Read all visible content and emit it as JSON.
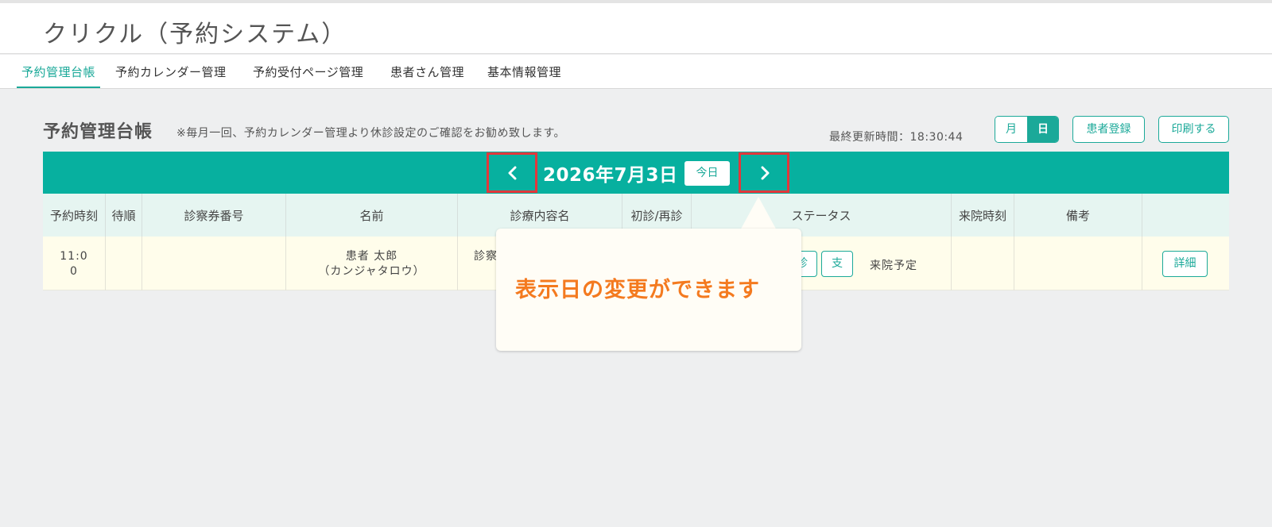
{
  "app": {
    "title": "クリクル（予約システム）"
  },
  "nav": {
    "tabs": [
      {
        "label": "予約管理台帳",
        "active": true
      },
      {
        "label": "予約カレンダー管理",
        "active": false
      },
      {
        "label": "予約受付ページ管理",
        "active": false
      },
      {
        "label": "患者さん管理",
        "active": false
      },
      {
        "label": "基本情報管理",
        "active": false
      }
    ]
  },
  "page": {
    "title": "予約管理台帳",
    "note": "※毎月一回、予約カレンダー管理より休診設定のご確認をお勧め致します。",
    "last_updated": "最終更新時間：18:30:44"
  },
  "view_toggle": {
    "month": "月",
    "day": "日",
    "selected": "日"
  },
  "actions": {
    "register_patient": "患者登録",
    "print": "印刷する"
  },
  "datebar": {
    "date": "2026年7月3日",
    "today": "今日"
  },
  "table": {
    "headers": [
      "予約時刻",
      "待順",
      "診察券番号",
      "名前",
      "診療内容名",
      "初診/再診",
      "ステータス",
      "来院時刻",
      "備考",
      ""
    ],
    "rows": [
      {
        "time_line1": "11:0",
        "time_line2": "0",
        "order": "",
        "card_no": "",
        "name": "患者 太郎",
        "kana": "（カンジャタロウ）",
        "course": "診察",
        "status_btn1": "診",
        "status_btn2": "支",
        "status": "来院予定",
        "arrival": "",
        "memo": "",
        "detail": "詳細"
      }
    ]
  },
  "callout": {
    "text": "表示日の変更ができます"
  },
  "colors": {
    "accent": "#1ba999",
    "bar": "#07b09f",
    "highlight": "#e3373b",
    "callout_text": "#f47a1f"
  },
  "icons": {
    "prev": "chevron-left-icon",
    "next": "chevron-right-icon"
  }
}
